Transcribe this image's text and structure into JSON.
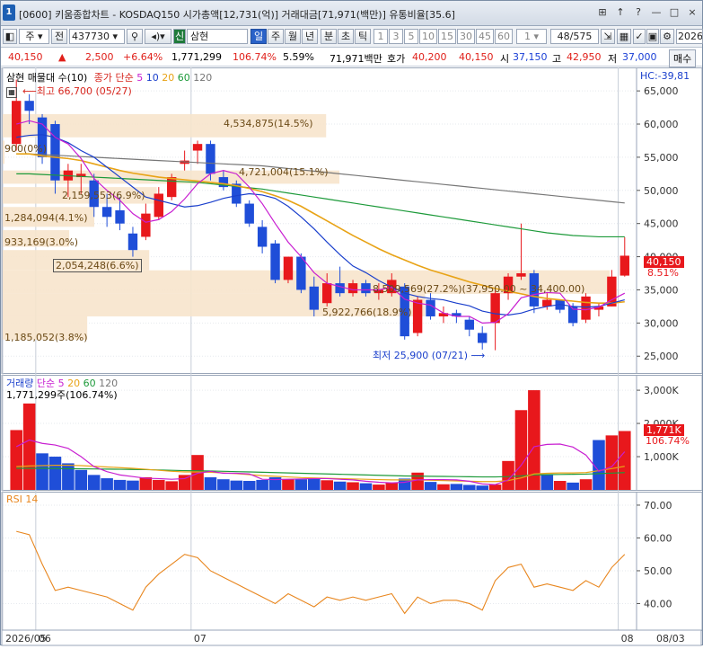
{
  "window": {
    "title": "[0600] 키움종합차트 - KOSDAQ150 시가총액[12,731(억)] 거래대금[71,971(백만)] 유통비율[35.6]",
    "icon": "chart-app-icon",
    "buttons": [
      "⊞",
      "↑",
      "?",
      "—",
      "□",
      "×"
    ]
  },
  "toolbar": {
    "period_label": "주",
    "all_label": "전",
    "code_value": "437730",
    "stock_tag": "신",
    "stock_name": "삼현",
    "timeframes": [
      "일",
      "주",
      "월",
      "년",
      "분",
      "초",
      "틱"
    ],
    "active_timeframe": "일",
    "intervals": [
      "1",
      "3",
      "5",
      "10",
      "15",
      "30",
      "45",
      "60"
    ],
    "count_value": "1",
    "page_value": "48/575",
    "date_value": "2026/",
    "icons": [
      "search-icon",
      "sound-icon",
      "arrow-icon",
      "grid-icon",
      "checkmark-icon",
      "save-icon",
      "gear-icon"
    ]
  },
  "quote": {
    "price": "40,150",
    "arrow": "▲",
    "change": "2,500",
    "change_pct": "+6.64%",
    "volume": "1,771,299",
    "volume_ratio": "106.74%",
    "turnover": "5.59%",
    "amount": "71,971백만",
    "hoga_label": "호가",
    "ask": "40,200",
    "bid": "40,150",
    "open_label": "시",
    "open": "37,150",
    "high_label": "고",
    "high": "42,950",
    "low_label": "저",
    "low": "37,000",
    "buy_label": "매수"
  },
  "price_panel": {
    "legend": {
      "name": "삼현 매물대 수(10)",
      "close_label": "종가 단순",
      "ma": [
        "5",
        "10",
        "20",
        "60",
        "120"
      ]
    },
    "hc_label": "HC:-39,81",
    "current_price_tag": "40,150",
    "current_pct_tag": "8.51%",
    "y_ticks": [
      "65,000",
      "60,000",
      "55,000",
      "50,000",
      "45,000",
      "40,000",
      "35,000",
      "30,000",
      "25,000"
    ],
    "high_annotation": "최고 66,700 (05/27)",
    "low_annotation": "최저 25,900 (07/21)",
    "volume_profile_labels": [
      "4,534,875(14.5%)",
      "900(0%)",
      "4,721,004(15.1%)",
      "2,159,553(6.9%)",
      "1,284,094(4.1%)",
      "933,169(3.0%)",
      "2,054,248(6.6%)",
      "8,509,569(27.2%)(37,950.00 ~ 34,400.00)",
      "5,922,766(18.9%)",
      "1,185,052(3.8%)"
    ]
  },
  "volume_panel": {
    "legend": {
      "name": "거래량",
      "label": "단순",
      "ma": [
        "5",
        "20",
        "60",
        "120"
      ]
    },
    "current_value": "1,771,299주(106.74%)",
    "y_ticks": [
      "3,000K",
      "2,000K",
      "1,000K"
    ],
    "tag_value": "1,771K",
    "tag_pct": "106.74%"
  },
  "rsi_panel": {
    "legend": "RSI 14",
    "y_ticks": [
      "70.00",
      "60.00",
      "50.00",
      "40.00"
    ]
  },
  "x_axis": {
    "labels": [
      "2026/05",
      "06",
      "07",
      "08",
      "08/03"
    ]
  },
  "colors": {
    "up": "#e8181c",
    "down": "#1f4ed8",
    "ma5": "#c81ed1",
    "ma10": "#1a3fcc",
    "ma20": "#e8a316",
    "ma60": "#1d9a3a",
    "ma120": "#777777",
    "profile": "#f7e4cc",
    "rsi": "#e8861e"
  },
  "chart_data": [
    {
      "type": "candlestick",
      "title": "삼현 매물대 수(10)",
      "ylim": [
        23000,
        68000
      ],
      "candles": [
        {
          "o": 57000,
          "h": 66700,
          "l": 56000,
          "c": 63500
        },
        {
          "o": 63500,
          "h": 64500,
          "l": 60000,
          "c": 62000
        },
        {
          "o": 61000,
          "h": 61500,
          "l": 54000,
          "c": 55000
        },
        {
          "o": 60000,
          "h": 60500,
          "l": 49500,
          "c": 51500
        },
        {
          "o": 51500,
          "h": 54000,
          "l": 49000,
          "c": 53000
        },
        {
          "o": 52000,
          "h": 54000,
          "l": 49500,
          "c": 52500
        },
        {
          "o": 51500,
          "h": 52500,
          "l": 46000,
          "c": 47500
        },
        {
          "o": 47500,
          "h": 49500,
          "l": 44500,
          "c": 46000
        },
        {
          "o": 47000,
          "h": 49000,
          "l": 44000,
          "c": 45000
        },
        {
          "o": 43500,
          "h": 44500,
          "l": 40000,
          "c": 41000
        },
        {
          "o": 43000,
          "h": 48000,
          "l": 42500,
          "c": 46500
        },
        {
          "o": 46000,
          "h": 50500,
          "l": 45500,
          "c": 49500
        },
        {
          "o": 49000,
          "h": 52500,
          "l": 48500,
          "c": 52000
        },
        {
          "o": 54000,
          "h": 56000,
          "l": 53000,
          "c": 54500
        },
        {
          "o": 56000,
          "h": 57500,
          "l": 54000,
          "c": 57000
        },
        {
          "o": 57000,
          "h": 57500,
          "l": 51500,
          "c": 52500
        },
        {
          "o": 52000,
          "h": 53000,
          "l": 50000,
          "c": 50500
        },
        {
          "o": 51000,
          "h": 51500,
          "l": 47500,
          "c": 48000
        },
        {
          "o": 48000,
          "h": 48500,
          "l": 44500,
          "c": 45000
        },
        {
          "o": 44500,
          "h": 45500,
          "l": 40500,
          "c": 41500
        },
        {
          "o": 42000,
          "h": 42500,
          "l": 36000,
          "c": 36500
        },
        {
          "o": 36500,
          "h": 40000,
          "l": 36000,
          "c": 40000
        },
        {
          "o": 40000,
          "h": 40500,
          "l": 34500,
          "c": 35000
        },
        {
          "o": 35500,
          "h": 37000,
          "l": 31000,
          "c": 32000
        },
        {
          "o": 33000,
          "h": 37500,
          "l": 32500,
          "c": 36000
        },
        {
          "o": 36000,
          "h": 38500,
          "l": 34000,
          "c": 34500
        },
        {
          "o": 34500,
          "h": 36500,
          "l": 34000,
          "c": 36000
        },
        {
          "o": 36000,
          "h": 36500,
          "l": 34000,
          "c": 34500
        },
        {
          "o": 34500,
          "h": 36000,
          "l": 33500,
          "c": 35000
        },
        {
          "o": 34500,
          "h": 37500,
          "l": 34000,
          "c": 36500
        },
        {
          "o": 35500,
          "h": 36000,
          "l": 27500,
          "c": 28000
        },
        {
          "o": 28500,
          "h": 34000,
          "l": 28000,
          "c": 33500
        },
        {
          "o": 33500,
          "h": 34500,
          "l": 30500,
          "c": 31000
        },
        {
          "o": 31000,
          "h": 32500,
          "l": 30000,
          "c": 31500
        },
        {
          "o": 31500,
          "h": 32000,
          "l": 30000,
          "c": 31000
        },
        {
          "o": 30500,
          "h": 31000,
          "l": 28000,
          "c": 29000
        },
        {
          "o": 28500,
          "h": 29500,
          "l": 26000,
          "c": 27000
        },
        {
          "o": 30000,
          "h": 35000,
          "l": 25900,
          "c": 34500
        },
        {
          "o": 34500,
          "h": 37500,
          "l": 33500,
          "c": 37000
        },
        {
          "o": 37000,
          "h": 45000,
          "l": 36500,
          "c": 37500
        },
        {
          "o": 37500,
          "h": 38000,
          "l": 31500,
          "c": 32500
        },
        {
          "o": 32500,
          "h": 34500,
          "l": 32000,
          "c": 33500
        },
        {
          "o": 33500,
          "h": 33500,
          "l": 31500,
          "c": 32000
        },
        {
          "o": 32500,
          "h": 33000,
          "l": 29500,
          "c": 30000
        },
        {
          "o": 30500,
          "h": 34500,
          "l": 30000,
          "c": 34000
        },
        {
          "o": 32000,
          "h": 33000,
          "l": 31000,
          "c": 32500
        },
        {
          "o": 32500,
          "h": 38000,
          "l": 32500,
          "c": 37000
        },
        {
          "o": 37150,
          "h": 42950,
          "l": 37000,
          "c": 40150
        }
      ],
      "ma5": [
        60000,
        60500,
        60000,
        58000,
        57000,
        54800,
        51800,
        50000,
        48500,
        46500,
        45200,
        45600,
        46800,
        48700,
        51000,
        52500,
        53000,
        52500,
        50500,
        48000,
        45000,
        42200,
        40000,
        37600,
        36000,
        35500,
        35000,
        35000,
        35000,
        35400,
        33600,
        33000,
        32700,
        31500,
        31000,
        31000,
        30000,
        30100,
        31400,
        33800,
        34300,
        34600,
        34500,
        32100,
        32000,
        32400,
        33500,
        34500
      ],
      "ma10": [
        58000,
        58300,
        58400,
        58000,
        57200,
        56000,
        55000,
        53500,
        52000,
        50500,
        49000,
        48500,
        48000,
        47500,
        47700,
        48200,
        48800,
        49200,
        49500,
        49300,
        48800,
        47600,
        46000,
        44200,
        42200,
        40300,
        38600,
        37600,
        36400,
        35400,
        34500,
        34000,
        33700,
        33500,
        33000,
        32600,
        31800,
        31400,
        31200,
        31500,
        32100,
        32500,
        32800,
        32500,
        32400,
        32500,
        33000,
        33500
      ],
      "ma20": [
        55500,
        55500,
        55200,
        55000,
        54800,
        54500,
        54000,
        53500,
        53000,
        52600,
        52300,
        52000,
        51800,
        51600,
        51400,
        51200,
        51000,
        50700,
        50300,
        49800,
        49200,
        48500,
        47600,
        46500,
        45400,
        44300,
        43200,
        42200,
        41200,
        40300,
        39500,
        38700,
        38000,
        37400,
        36800,
        36200,
        35700,
        35200,
        34800,
        34400,
        34000,
        33700,
        33500,
        33300,
        33100,
        33000,
        33000,
        33200
      ],
      "ma60": [
        52500,
        52500,
        52400,
        52300,
        52200,
        52100,
        52000,
        51900,
        51800,
        51700,
        51600,
        51500,
        51400,
        51300,
        51200,
        51000,
        50800,
        50600,
        50400,
        50200,
        49900,
        49600,
        49300,
        49000,
        48700,
        48400,
        48100,
        47800,
        47500,
        47200,
        46900,
        46600,
        46300,
        46000,
        45700,
        45400,
        45100,
        44800,
        44500,
        44200,
        43900,
        43600,
        43400,
        43200,
        43100,
        43000,
        43000,
        43000
      ],
      "ma120": [
        55500,
        55500,
        55400,
        55300,
        55200,
        55100,
        55000,
        54900,
        54800,
        54700,
        54600,
        54500,
        54400,
        54300,
        54200,
        54100,
        54000,
        53900,
        53800,
        53700,
        53500,
        53300,
        53100,
        52900,
        52700,
        52500,
        52300,
        52100,
        51900,
        51700,
        51500,
        51300,
        51100,
        50900,
        50700,
        50500,
        50300,
        50100,
        49900,
        49700,
        49500,
        49300,
        49100,
        48900,
        48700,
        48500,
        48300,
        48100
      ],
      "volume_profile": [
        {
          "lo": 58000,
          "hi": 61500,
          "value": 4534875
        },
        {
          "lo": 54000,
          "hi": 57500,
          "value": 900
        },
        {
          "lo": 51000,
          "hi": 53000,
          "value": 4721004
        },
        {
          "lo": 48000,
          "hi": 50500,
          "value": 2159553
        },
        {
          "lo": 44500,
          "hi": 47500,
          "value": 1284094
        },
        {
          "lo": 41500,
          "hi": 44000,
          "value": 933169
        },
        {
          "lo": 37950,
          "hi": 41000,
          "value": 2054248
        },
        {
          "lo": 34400,
          "hi": 37950,
          "value": 8509569
        },
        {
          "lo": 31000,
          "hi": 34400,
          "value": 5922766
        },
        {
          "lo": 27500,
          "hi": 31000,
          "value": 1185052
        }
      ]
    },
    {
      "type": "bar",
      "title": "거래량",
      "ylim": [
        0,
        3300000
      ],
      "values": [
        1800000,
        2600000,
        1100000,
        1000000,
        800000,
        600000,
        450000,
        350000,
        300000,
        280000,
        380000,
        300000,
        260000,
        450000,
        1050000,
        380000,
        320000,
        280000,
        270000,
        300000,
        380000,
        330000,
        320000,
        360000,
        290000,
        250000,
        230000,
        200000,
        160000,
        220000,
        340000,
        520000,
        240000,
        170000,
        180000,
        150000,
        130000,
        160000,
        870000,
        2400000,
        3000000,
        460000,
        270000,
        220000,
        320000,
        1500000,
        1640000,
        1771299
      ],
      "up": [
        true,
        true,
        false,
        false,
        false,
        false,
        false,
        false,
        false,
        false,
        true,
        true,
        true,
        true,
        true,
        false,
        false,
        false,
        false,
        false,
        false,
        true,
        false,
        false,
        true,
        false,
        true,
        false,
        true,
        true,
        false,
        true,
        false,
        true,
        false,
        false,
        false,
        true,
        true,
        true,
        true,
        false,
        true,
        false,
        true,
        false,
        true,
        true
      ],
      "ma5": [
        1300000,
        1500000,
        1400000,
        1350000,
        1250000,
        1000000,
        700000,
        550000,
        450000,
        400000,
        350000,
        340000,
        320000,
        340000,
        500000,
        560000,
        500000,
        500000,
        480000,
        320000,
        310000,
        320000,
        330000,
        340000,
        340000,
        320000,
        300000,
        260000,
        230000,
        210000,
        230000,
        300000,
        310000,
        310000,
        300000,
        260000,
        180000,
        160000,
        300000,
        740000,
        1300000,
        1370000,
        1380000,
        1290000,
        1050000,
        560000,
        700000,
        1150000
      ],
      "ma20": [
        700000,
        720000,
        730000,
        740000,
        740000,
        730000,
        710000,
        690000,
        670000,
        650000,
        620000,
        590000,
        560000,
        540000,
        540000,
        530000,
        510000,
        490000,
        460000,
        430000,
        410000,
        390000,
        370000,
        360000,
        350000,
        340000,
        330000,
        320000,
        310000,
        300000,
        300000,
        300000,
        290000,
        280000,
        270000,
        260000,
        250000,
        250000,
        280000,
        360000,
        480000,
        500000,
        510000,
        510000,
        520000,
        580000,
        640000,
        710000
      ],
      "ma60": [
        650000,
        650000,
        650000,
        645000,
        640000,
        635000,
        630000,
        625000,
        620000,
        615000,
        610000,
        600000,
        590000,
        580000,
        575000,
        570000,
        560000,
        550000,
        540000,
        530000,
        520000,
        510000,
        500000,
        490000,
        480000,
        470000,
        460000,
        450000,
        440000,
        430000,
        420000,
        415000,
        410000,
        405000,
        400000,
        395000,
        390000,
        390000,
        400000,
        420000,
        450000,
        460000,
        465000,
        470000,
        475000,
        490000,
        505000,
        520000
      ]
    },
    {
      "type": "line",
      "title": "RSI 14",
      "ylim": [
        33,
        73
      ],
      "values": [
        62,
        61,
        52,
        44,
        45,
        44,
        43,
        42,
        40,
        38,
        45,
        49,
        52,
        55,
        54,
        50,
        48,
        46,
        44,
        42,
        40,
        43,
        41,
        39,
        42,
        41,
        42,
        41,
        42,
        43,
        37,
        42,
        40,
        41,
        41,
        40,
        38,
        47,
        51,
        52,
        45,
        46,
        45,
        44,
        47,
        45,
        51,
        55
      ]
    }
  ]
}
